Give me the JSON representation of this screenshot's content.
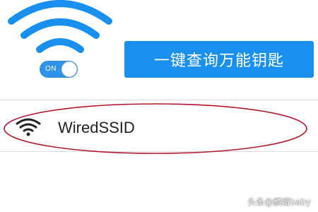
{
  "header": {
    "toggle": {
      "label": "ON",
      "state": "on"
    },
    "query_button_label": "一键查询万能钥匙"
  },
  "networks": [
    {
      "ssid": "WiredSSID",
      "icon": "wifi-icon"
    }
  ],
  "colors": {
    "accent": "#1a90ee",
    "toggle": "#2f94e9",
    "highlight": "#b2182b"
  },
  "watermark": "头条@麟婿baby"
}
